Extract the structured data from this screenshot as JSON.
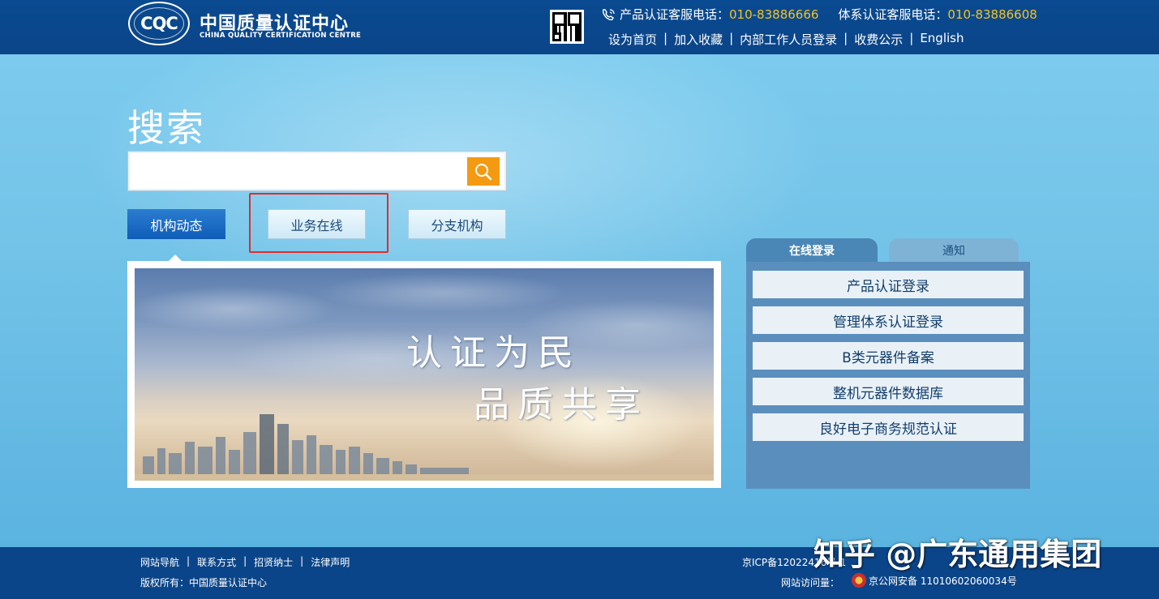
{
  "header": {
    "logo_mark": "CQC",
    "logo_cn": "中国质量认证中心",
    "logo_en": "CHINA QUALITY CERTIFICATION CENTRE",
    "hotline1_label": "产品认证客服电话：",
    "hotline1_number": "010-83886666",
    "hotline2_label": "体系认证客服电话：",
    "hotline2_number": "010-83886608",
    "links": [
      "设为首页",
      "加入收藏",
      "内部工作人员登录",
      "收费公示",
      "English"
    ],
    "separator": "|"
  },
  "search": {
    "title": "搜索",
    "placeholder": ""
  },
  "tabs": [
    "机构动态",
    "业务在线",
    "分支机构"
  ],
  "banner": {
    "slogan_line1": "认证为民",
    "slogan_line2": "品质共享"
  },
  "panel": {
    "tab_active": "在线登录",
    "tab_other": "通知",
    "buttons": [
      "产品认证登录",
      "管理体系认证登录",
      "B类元器件备案",
      "整机元器件数据库",
      "良好电子商务规范认证"
    ]
  },
  "footer": {
    "links": [
      "网站导航",
      "联系方式",
      "招贤纳士",
      "法律声明"
    ],
    "separator": "|",
    "copyright": "版权所有：中国质量认证中心",
    "icp": "京ICP备12022416号-1",
    "visits_label": "网站访问量：",
    "police": "京公网安备 11010602060034号"
  },
  "watermark": "知乎 @广东通用集团",
  "colors": {
    "header_bg": "#0b4589",
    "hotline_number": "#f7c21c",
    "search_button": "#f39a12",
    "tab_active": "#0e5db8",
    "highlight": "#e32b2b",
    "panel_bg": "#5a8fbd"
  }
}
